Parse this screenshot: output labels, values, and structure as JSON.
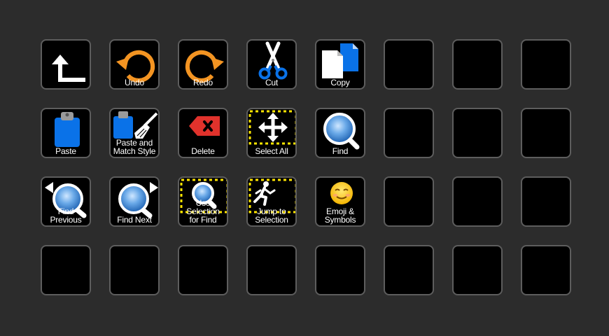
{
  "colors": {
    "background": "#2c2c2c",
    "key": "#000000",
    "key_border": "#5d5d5d",
    "accent_orange": "#f39422",
    "accent_blue": "#0a72e8",
    "accent_red": "#e0322c",
    "accent_yellow": "#ffe600"
  },
  "keys": [
    {
      "name": "back-key",
      "icon": "back-arrow-icon",
      "label": ""
    },
    {
      "name": "undo-key",
      "icon": "undo-icon",
      "label": "Undo"
    },
    {
      "name": "redo-key",
      "icon": "redo-icon",
      "label": "Redo"
    },
    {
      "name": "cut-key",
      "icon": "scissors-icon",
      "label": "Cut"
    },
    {
      "name": "copy-key",
      "icon": "copy-documents-icon",
      "label": "Copy"
    },
    {
      "name": "empty-key",
      "icon": "",
      "label": ""
    },
    {
      "name": "empty-key",
      "icon": "",
      "label": ""
    },
    {
      "name": "empty-key",
      "icon": "",
      "label": ""
    },
    {
      "name": "paste-key",
      "icon": "clipboard-icon",
      "label": "Paste"
    },
    {
      "name": "paste-match-style-key",
      "icon": "clipboard-brush-icon",
      "label": "Paste and\nMatch Style"
    },
    {
      "name": "delete-key",
      "icon": "delete-backspace-icon",
      "label": "Delete"
    },
    {
      "name": "select-all-key",
      "icon": "select-all-move-icon",
      "label": "Select All"
    },
    {
      "name": "find-key",
      "icon": "magnifier-icon",
      "label": "Find"
    },
    {
      "name": "empty-key",
      "icon": "",
      "label": ""
    },
    {
      "name": "empty-key",
      "icon": "",
      "label": ""
    },
    {
      "name": "empty-key",
      "icon": "",
      "label": ""
    },
    {
      "name": "find-previous-key",
      "icon": "find-previous-icon",
      "label": "Find Previous"
    },
    {
      "name": "find-next-key",
      "icon": "find-next-icon",
      "label": "Find Next"
    },
    {
      "name": "use-selection-for-find-key",
      "icon": "selection-magnifier-icon",
      "label": "Use Selection\nfor Find"
    },
    {
      "name": "jump-to-selection-key",
      "icon": "jump-runner-icon",
      "label": "Jump to\nSelection"
    },
    {
      "name": "emoji-symbols-key",
      "icon": "smiley-face-icon",
      "label": "Emoji &\nSymbols"
    },
    {
      "name": "empty-key",
      "icon": "",
      "label": ""
    },
    {
      "name": "empty-key",
      "icon": "",
      "label": ""
    },
    {
      "name": "empty-key",
      "icon": "",
      "label": ""
    },
    {
      "name": "empty-key",
      "icon": "",
      "label": ""
    },
    {
      "name": "empty-key",
      "icon": "",
      "label": ""
    },
    {
      "name": "empty-key",
      "icon": "",
      "label": ""
    },
    {
      "name": "empty-key",
      "icon": "",
      "label": ""
    },
    {
      "name": "empty-key",
      "icon": "",
      "label": ""
    },
    {
      "name": "empty-key",
      "icon": "",
      "label": ""
    },
    {
      "name": "empty-key",
      "icon": "",
      "label": ""
    },
    {
      "name": "empty-key",
      "icon": "",
      "label": ""
    }
  ]
}
